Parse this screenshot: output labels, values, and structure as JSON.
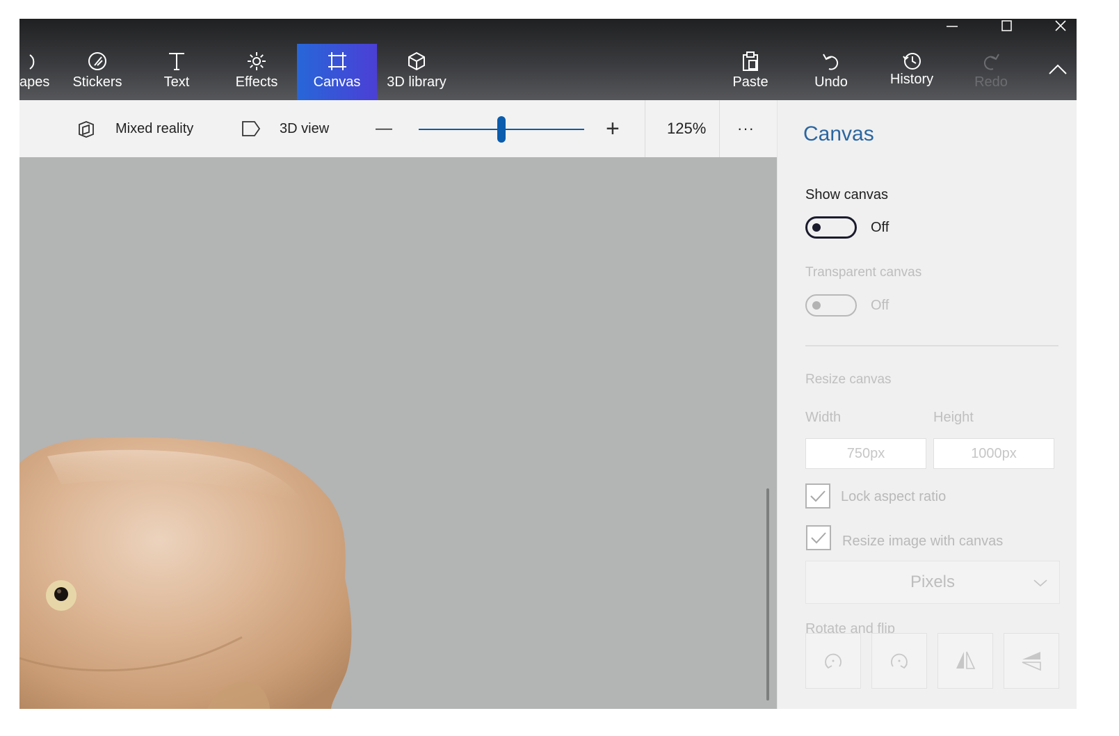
{
  "ribbon": {
    "tools": [
      {
        "label": "apes",
        "icon": "shapes-icon"
      },
      {
        "label": "Stickers",
        "icon": "sticker-icon"
      },
      {
        "label": "Text",
        "icon": "text-icon"
      },
      {
        "label": "Effects",
        "icon": "sun-icon"
      },
      {
        "label": "Canvas",
        "icon": "canvas-icon"
      },
      {
        "label": "3D library",
        "icon": "cube-icon"
      }
    ],
    "actions": [
      {
        "label": "Paste",
        "icon": "paste-icon"
      },
      {
        "label": "Undo",
        "icon": "undo-icon"
      },
      {
        "label": "History",
        "icon": "history-icon"
      },
      {
        "label": "Redo",
        "icon": "redo-icon"
      }
    ]
  },
  "toolbar": {
    "mixed_reality": "Mixed reality",
    "view_3d": "3D view",
    "zoom_minus": "—",
    "zoom_plus": "+",
    "zoom_level": "125%",
    "zoom_slider_fraction": 0.5,
    "more": "···"
  },
  "panel": {
    "title": "Canvas",
    "show_canvas_label": "Show canvas",
    "show_canvas_state": "Off",
    "transparent_canvas_label": "Transparent canvas",
    "transparent_canvas_state": "Off",
    "resize_canvas_label": "Resize canvas",
    "width_label": "Width",
    "height_label": "Height",
    "width_value": "750px",
    "height_value": "1000px",
    "lock_aspect_label": "Lock aspect ratio",
    "resize_image_label": "Resize image with canvas",
    "unit_selected": "Pixels",
    "rotate_flip_label": "Rotate and flip"
  },
  "colors": {
    "accent": "#2767d8",
    "panel_title": "#2b66a0",
    "slider": "#0b5cad",
    "workspace": "#b3b4b4"
  }
}
